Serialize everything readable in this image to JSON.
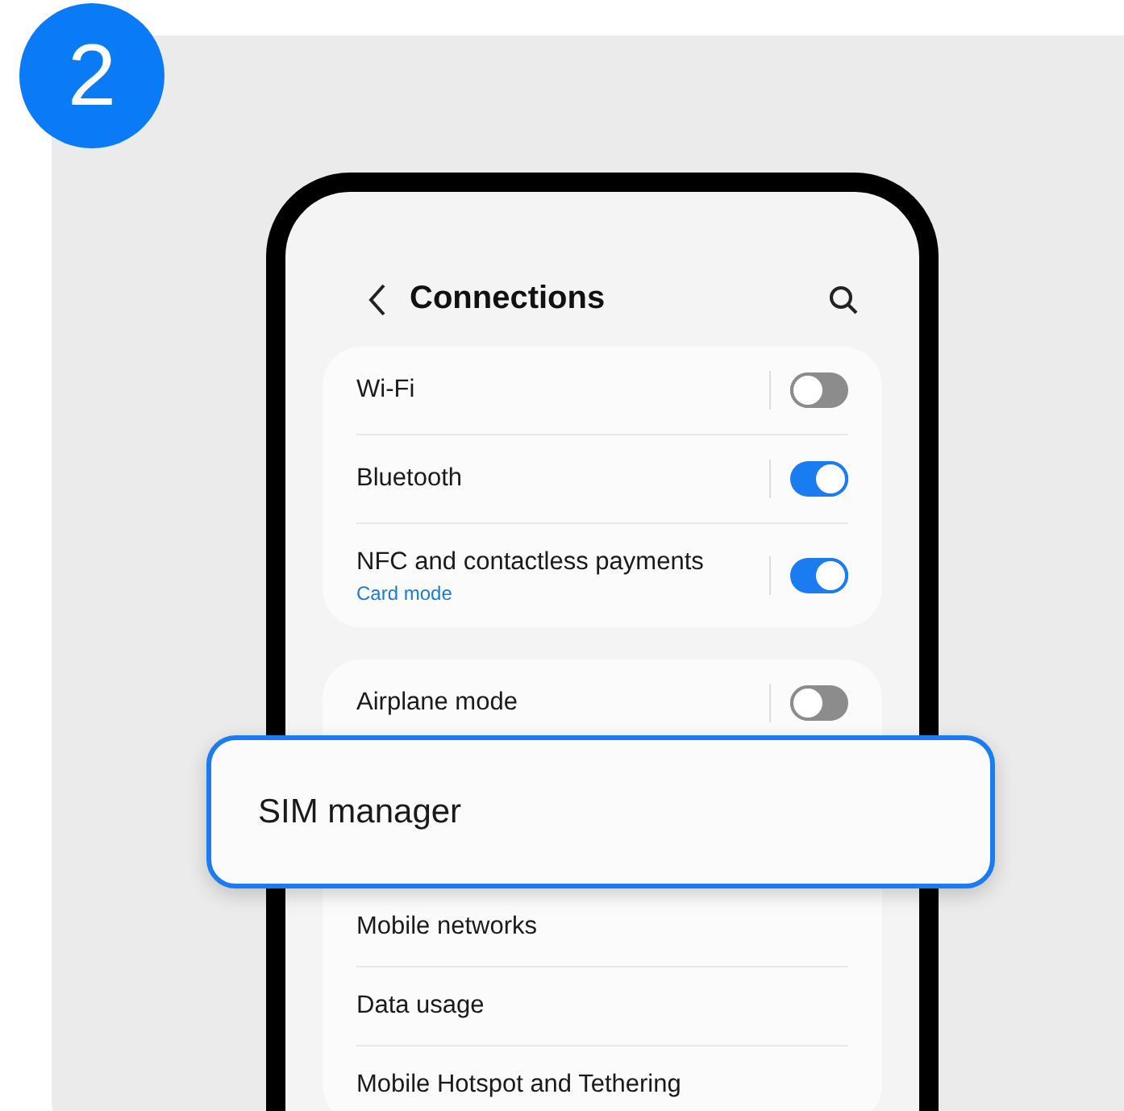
{
  "step_badge": "2",
  "header": {
    "title": "Connections"
  },
  "groups": [
    {
      "items": [
        {
          "kind": "toggle",
          "label": "Wi-Fi",
          "on": false
        },
        {
          "kind": "toggle",
          "label": "Bluetooth",
          "on": true
        },
        {
          "kind": "toggle",
          "label": "NFC and contactless payments",
          "subtitle": "Card mode",
          "on": true
        }
      ]
    },
    {
      "items": [
        {
          "kind": "toggle",
          "label": "Airplane mode",
          "on": false
        },
        {
          "kind": "highlighted",
          "label": "SIM manager"
        },
        {
          "kind": "link",
          "label": "Mobile networks"
        },
        {
          "kind": "link",
          "label": "Data usage"
        },
        {
          "kind": "link",
          "label": "Mobile Hotspot and Tethering"
        }
      ]
    }
  ]
}
